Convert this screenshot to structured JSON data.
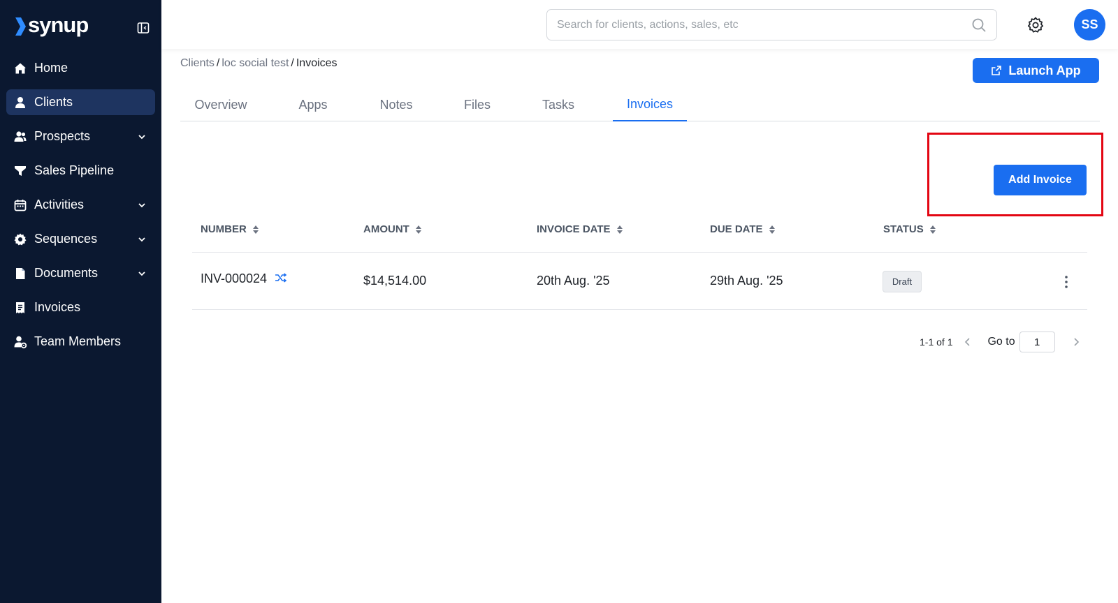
{
  "app": {
    "logo_text": "synup"
  },
  "sidebar": {
    "items": [
      {
        "label": "Home"
      },
      {
        "label": "Clients"
      },
      {
        "label": "Prospects"
      },
      {
        "label": "Sales Pipeline"
      },
      {
        "label": "Activities"
      },
      {
        "label": "Sequences"
      },
      {
        "label": "Documents"
      },
      {
        "label": "Invoices"
      },
      {
        "label": "Team Members"
      }
    ]
  },
  "header": {
    "search_placeholder": "Search for clients, actions, sales, etc",
    "avatar_initials": "SS"
  },
  "breadcrumb": {
    "root": "Clients",
    "client": "loc social test",
    "current": "Invoices",
    "separator": "/"
  },
  "launch_app_label": "Launch App",
  "tabs": [
    {
      "label": "Overview"
    },
    {
      "label": "Apps"
    },
    {
      "label": "Notes"
    },
    {
      "label": "Files"
    },
    {
      "label": "Tasks"
    },
    {
      "label": "Invoices"
    }
  ],
  "add_invoice_label": "Add Invoice",
  "table": {
    "columns": [
      "NUMBER",
      "AMOUNT",
      "INVOICE DATE",
      "DUE DATE",
      "STATUS"
    ],
    "rows": [
      {
        "number": "INV-000024",
        "amount": "$14,514.00",
        "invoice_date": "20th Aug. '25",
        "due_date": "29th Aug. '25",
        "status": "Draft"
      }
    ]
  },
  "pagination": {
    "range": "1-1 of 1",
    "goto_label": "Go to",
    "page": "1"
  },
  "colors": {
    "sidebar_bg": "#0b1830",
    "accent": "#1a6ef0",
    "highlight": "#e30613"
  }
}
